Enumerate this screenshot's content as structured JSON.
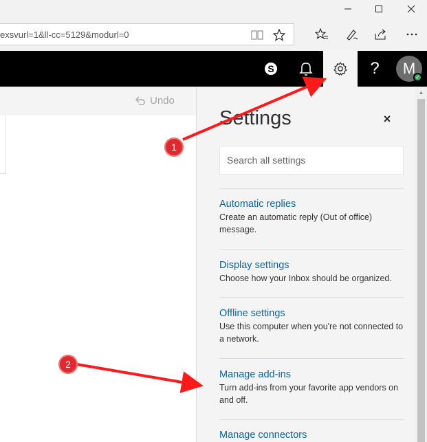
{
  "browser": {
    "url_fragment": "exsvurl=1&ll-cc=5129&modurl=0",
    "window_controls": {
      "minimize": "minimize-icon",
      "maximize": "maximize-icon",
      "close": "close-icon"
    },
    "toolbar_icons": [
      "reading-view-icon",
      "favorite-star-icon",
      "favorites-hub-icon",
      "web-note-icon",
      "share-icon",
      "more-icon"
    ]
  },
  "appbar": {
    "skype_label": "S",
    "help_label": "?",
    "avatar_initial": "M"
  },
  "command_bar": {
    "undo_label": "Undo"
  },
  "settings": {
    "title": "Settings",
    "close_glyph": "×",
    "search_placeholder": "Search all settings",
    "items": [
      {
        "title": "Automatic replies",
        "description": "Create an automatic reply (Out of office) message."
      },
      {
        "title": "Display settings",
        "description": "Choose how your Inbox should be organized."
      },
      {
        "title": "Offline settings",
        "description": "Use this computer when you're not connected to a network."
      },
      {
        "title": "Manage add-ins",
        "description": "Turn add-ins from your favorite app vendors on and off."
      },
      {
        "title": "Manage connectors",
        "description": ""
      }
    ]
  },
  "annotations": {
    "step1": "1",
    "step2": "2",
    "arrow_color": "#ff1a1a"
  },
  "colors": {
    "appbar_bg": "#000000",
    "link": "#0a64a4",
    "panel_bg": "#f4f4f4",
    "badge": "#e0282e"
  }
}
